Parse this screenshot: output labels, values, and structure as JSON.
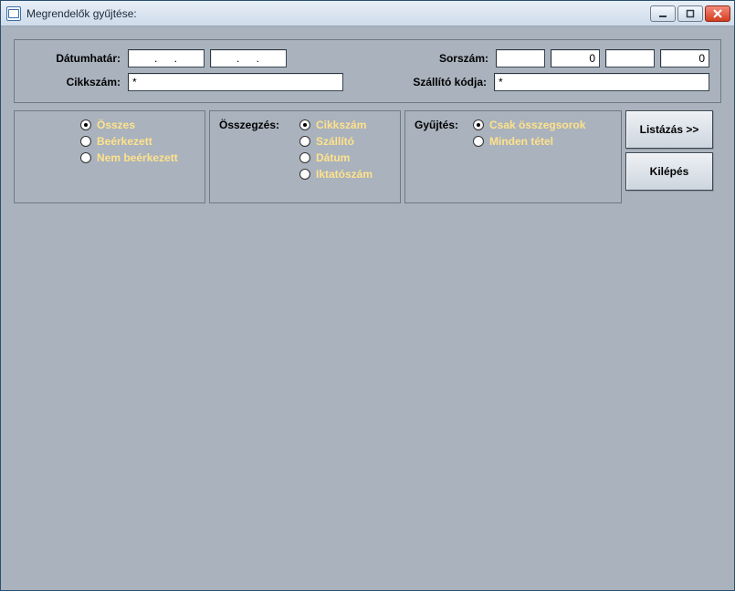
{
  "window": {
    "title": "Megrendelők gyűjtése:"
  },
  "labels": {
    "datumhatar": "Dátumhatár:",
    "cikkszam": "Cikkszám:",
    "sorszam": "Sorszám:",
    "szallito_kodja": "Szállító kódja:"
  },
  "inputs": {
    "date1": ".    .",
    "date2": ".    .",
    "sorszam1": "",
    "sorszam2": "0",
    "sorszam3": "",
    "sorszam4": "0",
    "cikkszam": "*",
    "szallito": "*"
  },
  "status_group": {
    "options": [
      {
        "id": "osszes",
        "label": "Összes",
        "selected": true
      },
      {
        "id": "beerkezett",
        "label": "Beérkezett",
        "selected": false
      },
      {
        "id": "nem_beerkezett",
        "label": "Nem beérkezett",
        "selected": false
      }
    ]
  },
  "osszegzes": {
    "label": "Összegzés:",
    "options": [
      {
        "id": "cikkszam",
        "label": "Cikkszám",
        "selected": true
      },
      {
        "id": "szallito",
        "label": "Szállító",
        "selected": false
      },
      {
        "id": "datum",
        "label": "Dátum",
        "selected": false
      },
      {
        "id": "iktatoszam",
        "label": "Iktatószám",
        "selected": false
      }
    ]
  },
  "gyujtes": {
    "label": "Gyűjtés:",
    "options": [
      {
        "id": "csak_osszegsorok",
        "label": "Csak összegsorok",
        "selected": true
      },
      {
        "id": "minden_tetel",
        "label": "Minden tétel",
        "selected": false
      }
    ]
  },
  "buttons": {
    "listazas": "Listázás >>",
    "kilepes": "Kilépés"
  }
}
